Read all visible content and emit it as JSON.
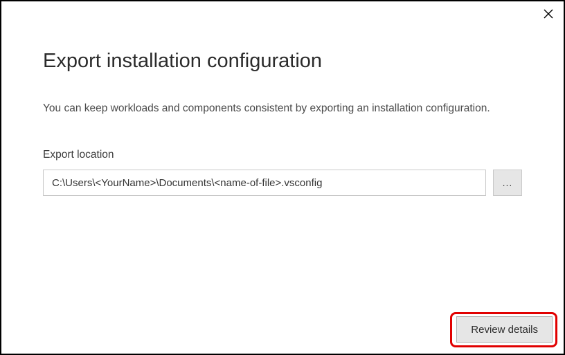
{
  "dialog": {
    "title": "Export installation configuration",
    "description": "You can keep workloads and components consistent by exporting an installation configuration.",
    "exportLocationLabel": "Export location",
    "exportLocationValue": "C:\\Users\\<YourName>\\Documents\\<name-of-file>.vsconfig",
    "browseLabel": "...",
    "reviewButtonLabel": "Review details"
  }
}
